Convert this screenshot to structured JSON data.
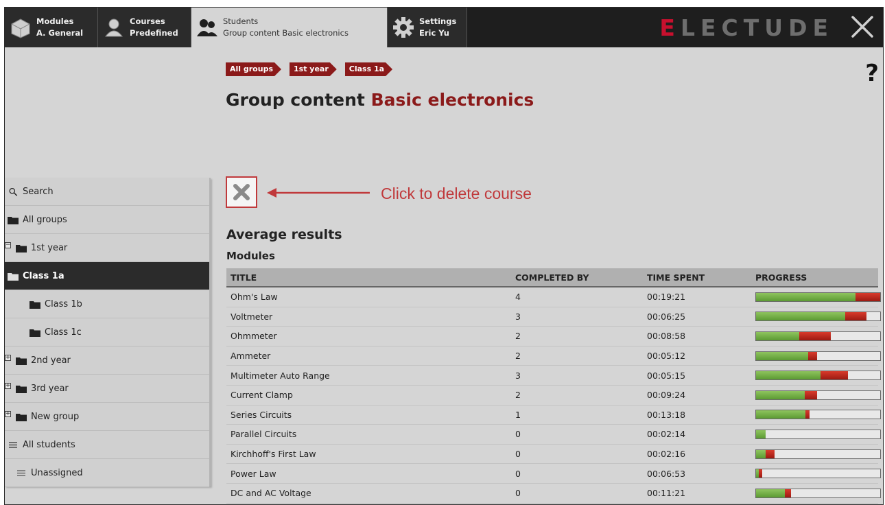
{
  "topbar": {
    "tabs": [
      {
        "line1": "Modules",
        "line2": "A. General"
      },
      {
        "line1": "Courses",
        "line2": "Predefined"
      },
      {
        "line1": "Students",
        "line2": "Group content Basic electronics"
      },
      {
        "line1": "Settings",
        "line2": "Eric Yu"
      }
    ],
    "brand_first": "E",
    "brand_rest": "LECTUDE"
  },
  "breadcrumb": [
    "All groups",
    "1st year",
    "Class 1a"
  ],
  "help_label": "?",
  "page_title": {
    "prefix": "Group content",
    "accent": "Basic electronics"
  },
  "annotation": "Click to delete course",
  "sidebar": {
    "search": "Search",
    "items": [
      "All groups",
      "1st year",
      "Class 1a",
      "Class 1b",
      "Class 1c",
      "2nd year",
      "3rd year",
      "New group",
      "All students",
      "Unassigned"
    ]
  },
  "results": {
    "heading": "Average results",
    "subheading": "Modules",
    "columns": [
      "TITLE",
      "COMPLETED BY",
      "TIME SPENT",
      "PROGRESS"
    ],
    "rows": [
      {
        "title": "Ohm's Law",
        "completed": "4",
        "time": "00:19:21",
        "green": 0.8,
        "red": 0.2
      },
      {
        "title": "Voltmeter",
        "completed": "3",
        "time": "00:06:25",
        "green": 0.72,
        "red": 0.17
      },
      {
        "title": "Ohmmeter",
        "completed": "2",
        "time": "00:08:58",
        "green": 0.35,
        "red": 0.25
      },
      {
        "title": "Ammeter",
        "completed": "2",
        "time": "00:05:12",
        "green": 0.42,
        "red": 0.07
      },
      {
        "title": "Multimeter Auto Range",
        "completed": "3",
        "time": "00:05:15",
        "green": 0.52,
        "red": 0.22
      },
      {
        "title": "Current Clamp",
        "completed": "2",
        "time": "00:09:24",
        "green": 0.39,
        "red": 0.1
      },
      {
        "title": "Series Circuits",
        "completed": "1",
        "time": "00:13:18",
        "green": 0.4,
        "red": 0.03
      },
      {
        "title": "Parallel Circuits",
        "completed": "0",
        "time": "00:02:14",
        "green": 0.08,
        "red": 0.0
      },
      {
        "title": "Kirchhoff's First Law",
        "completed": "0",
        "time": "00:02:16",
        "green": 0.08,
        "red": 0.07
      },
      {
        "title": "Power Law",
        "completed": "0",
        "time": "00:06:53",
        "green": 0.02,
        "red": 0.03
      },
      {
        "title": "DC and AC Voltage",
        "completed": "0",
        "time": "00:11:21",
        "green": 0.23,
        "red": 0.05
      }
    ]
  },
  "colors": {
    "accent": "#8b1a1a",
    "annotation": "#c0393b",
    "progress_green": "#6aa83e",
    "progress_red": "#b8251a"
  }
}
